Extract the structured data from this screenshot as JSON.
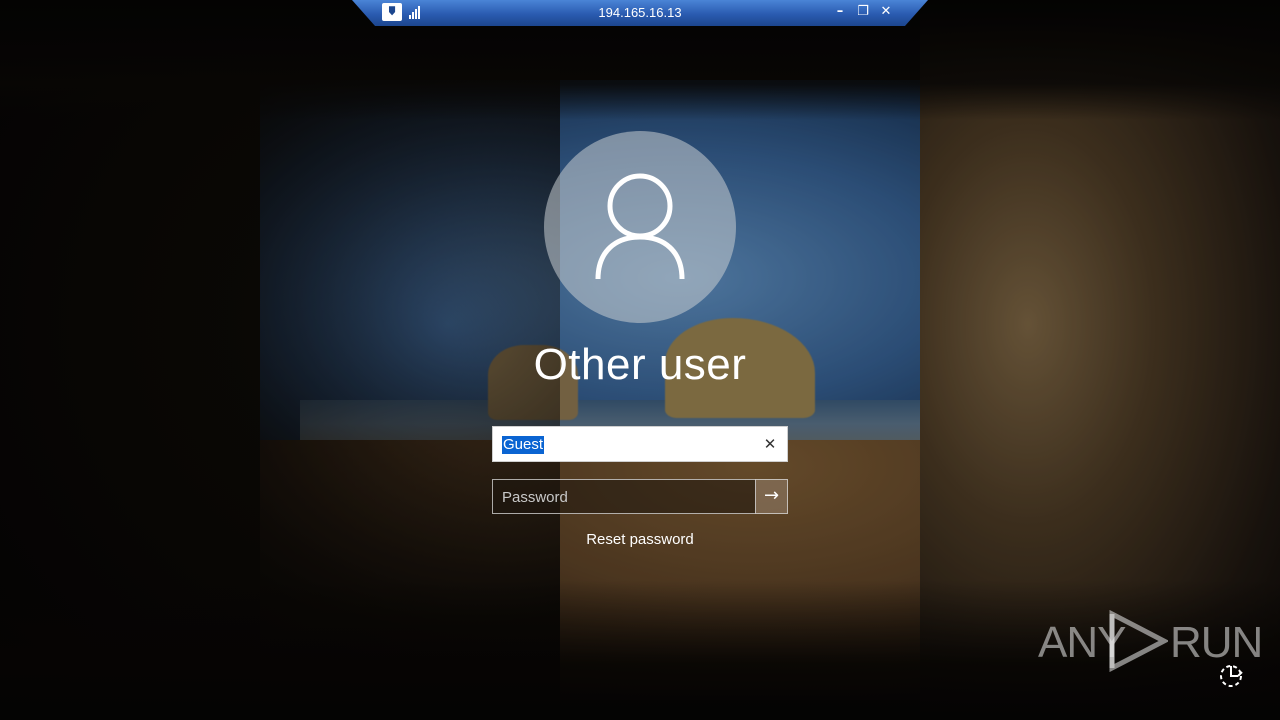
{
  "rdp_bar": {
    "host": "194.165.16.13",
    "pin_glyph": "🠷",
    "minimize_glyph": "–",
    "restore_glyph": "❐",
    "close_glyph": "✕"
  },
  "login": {
    "account_name": "Other user",
    "username_value": "Guest",
    "clear_glyph": "✕",
    "password_placeholder": "Password",
    "submit_glyph": "→",
    "reset_link": "Reset password"
  },
  "watermark": {
    "left": "ANY",
    "right": "RUN"
  },
  "icons": [
    "user-avatar-icon",
    "signal-icon",
    "pin-icon",
    "ease-of-access-icon"
  ]
}
